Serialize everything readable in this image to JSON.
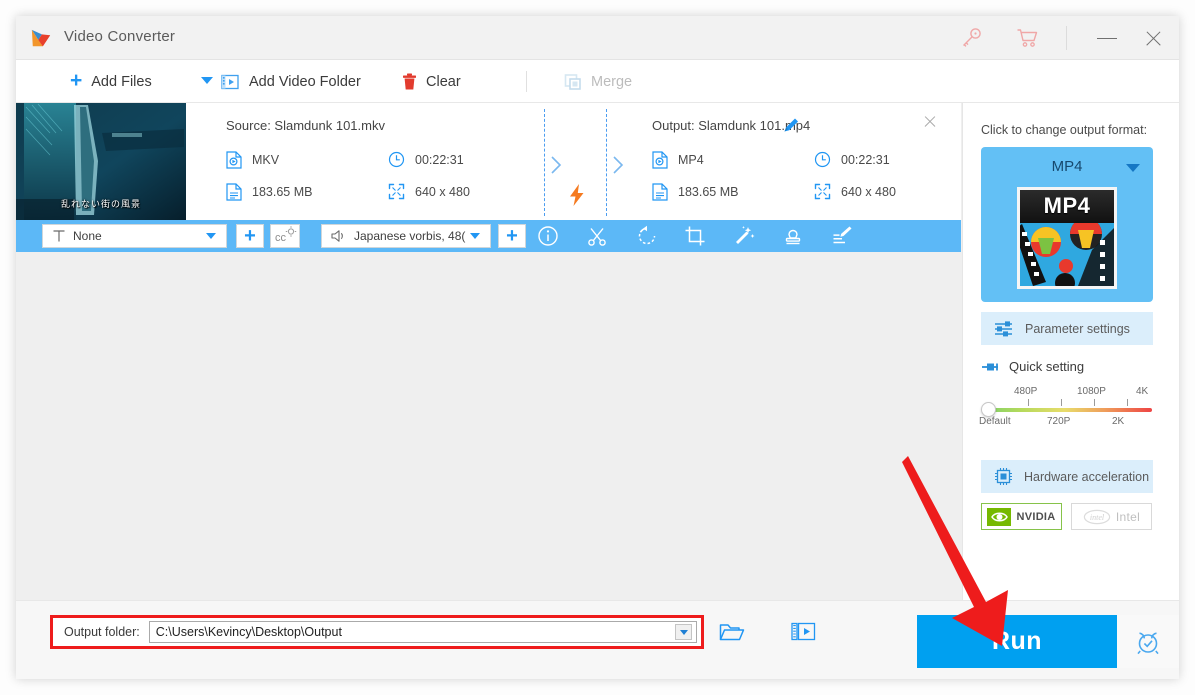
{
  "window": {
    "title": "Video Converter",
    "logo_icon": "play-triangle-logo",
    "titlebar_icons": [
      "key-icon",
      "cart-icon"
    ],
    "minimize_label": "–",
    "close_label": "×"
  },
  "menubar": {
    "add_files": "Add Files",
    "add_files_caret": "chevron-down-icon",
    "add_video_folder": "Add Video Folder",
    "clear": "Clear",
    "merge": "Merge"
  },
  "file_card": {
    "thumbnail_subtitle": "乱れない街の風景",
    "source": {
      "title": "Source: Slamdunk 101.mkv",
      "format": "MKV",
      "duration": "00:22:31",
      "size": "183.65 MB",
      "resolution": "640 x 480"
    },
    "output": {
      "title": "Output: Slamdunk 101.mp4",
      "format": "MP4",
      "duration": "00:22:31",
      "size": "183.65 MB",
      "resolution": "640 x 480",
      "edit_icon": "pencil-icon"
    },
    "remove_label": "×",
    "bolt_icon": "lightning-bolt-icon"
  },
  "track_bar": {
    "subtitle_value": "None",
    "subtitle_icon": "subtitle-T-icon",
    "subtitle_add": "+",
    "cc_button": "cc-icon",
    "audio_value": "Japanese vorbis, 48(",
    "audio_icon": "speaker-icon",
    "audio_add": "+",
    "tools": [
      "info-icon",
      "scissors-cut-icon",
      "rotate-icon",
      "crop-icon",
      "effects-wand-icon",
      "watermark-stamp-icon",
      "subtitle-edit-icon"
    ]
  },
  "right_panel": {
    "format_label": "Click to change output format:",
    "format_name": "MP4",
    "format_thumb_badge": "MP4",
    "parameter_settings": "Parameter settings",
    "quick_setting": "Quick setting",
    "quality_slider": {
      "top_labels": [
        "480P",
        "1080P",
        "4K"
      ],
      "bottom_labels": [
        "Default",
        "720P",
        "2K"
      ],
      "value": "Default"
    },
    "hardware_acceleration": "Hardware acceleration",
    "gpus": [
      {
        "name": "NVIDIA",
        "active": true
      },
      {
        "name": "Intel",
        "active": false
      }
    ]
  },
  "bottom_bar": {
    "output_folder_label": "Output folder:",
    "output_folder_value": "C:\\Users\\Kevincy\\Desktop\\Output",
    "folder_icon": "open-folder-icon",
    "media_icon": "media-library-icon",
    "run_label": "Run",
    "alarm_icon": "alarm-clock-icon"
  },
  "annotation": {
    "arrow": "red-arrow-pointing-to-run"
  },
  "colors": {
    "accent_blue": "#00a0f0",
    "strip_blue": "#5cb8f7",
    "card_blue": "#63c0f5",
    "annotation_red": "#ee1c1c",
    "nvidia_green": "#76b900",
    "bolt_orange": "#f57a20"
  }
}
